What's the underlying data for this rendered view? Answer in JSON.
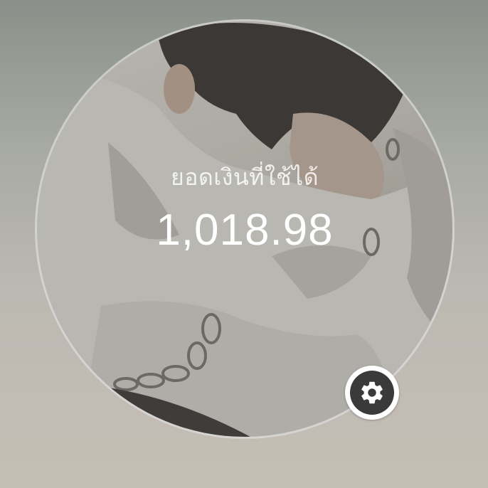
{
  "balance": {
    "label": "ยอดเงินที่ใช้ได้",
    "amount": "1,018.98"
  },
  "settings": {
    "icon": "gear-icon"
  },
  "colors": {
    "label_text": "#d9d9d9",
    "amount_text": "#ffffff",
    "settings_bg": "#3a3a3a"
  }
}
